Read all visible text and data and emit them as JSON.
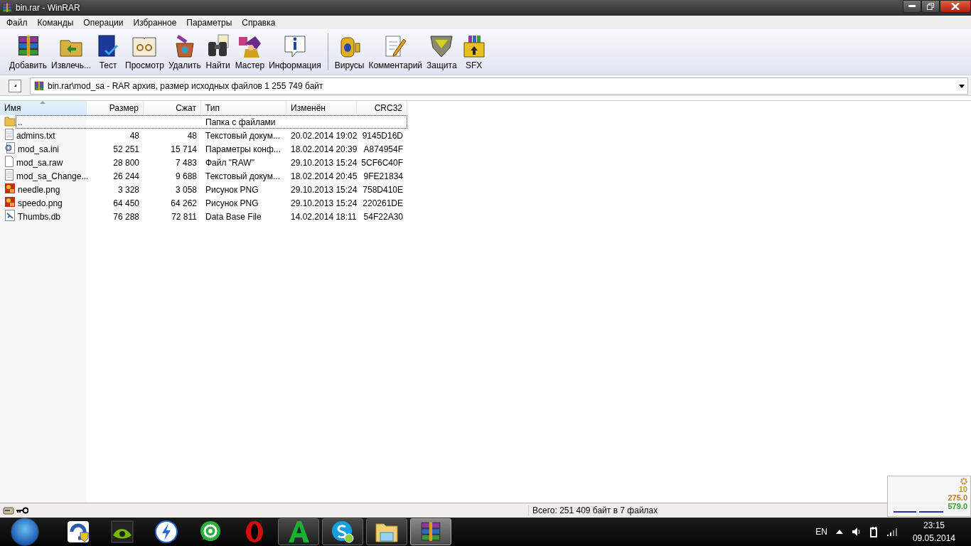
{
  "window": {
    "title": "bin.rar - WinRAR"
  },
  "menu": [
    "Файл",
    "Команды",
    "Операции",
    "Избранное",
    "Параметры",
    "Справка"
  ],
  "toolbar": {
    "groups": [
      [
        {
          "label": "Добавить",
          "kind": "add"
        },
        {
          "label": "Извлечь...",
          "kind": "extract"
        },
        {
          "label": "Тест",
          "kind": "test"
        },
        {
          "label": "Просмотр",
          "kind": "view"
        },
        {
          "label": "Удалить",
          "kind": "delete"
        },
        {
          "label": "Найти",
          "kind": "find"
        },
        {
          "label": "Мастер",
          "kind": "wizard"
        },
        {
          "label": "Информация",
          "kind": "info"
        }
      ],
      [
        {
          "label": "Вирусы",
          "kind": "virus"
        },
        {
          "label": "Комментарий",
          "kind": "comment"
        },
        {
          "label": "Защита",
          "kind": "protect"
        },
        {
          "label": "SFX",
          "kind": "sfx"
        }
      ]
    ]
  },
  "address": {
    "path": "bin.rar\\mod_sa - RAR архив, размер исходных файлов 1 255 749 байт"
  },
  "table": {
    "columns": [
      {
        "label": "Имя",
        "sorted": true
      },
      {
        "label": "Размер",
        "sorted": false
      },
      {
        "label": "Сжат",
        "sorted": false
      },
      {
        "label": "Тип",
        "sorted": false
      },
      {
        "label": "Изменён",
        "sorted": false
      },
      {
        "label": "CRC32",
        "sorted": false
      }
    ],
    "rows": [
      {
        "kind": "folder",
        "focused": true,
        "name": "..",
        "size": "",
        "packed": "",
        "type": "Папка с файлами",
        "modified": "",
        "crc": ""
      },
      {
        "kind": "text",
        "focused": false,
        "name": "admins.txt",
        "size": "48",
        "packed": "48",
        "type": "Текстовый докум...",
        "modified": "20.02.2014 19:02",
        "crc": "9145D16D"
      },
      {
        "kind": "settings",
        "focused": false,
        "name": "mod_sa.ini",
        "size": "52 251",
        "packed": "15 714",
        "type": "Параметры конф...",
        "modified": "18.02.2014 20:39",
        "crc": "A874954F"
      },
      {
        "kind": "file",
        "focused": false,
        "name": "mod_sa.raw",
        "size": "28 800",
        "packed": "7 483",
        "type": "Файл \"RAW\"",
        "modified": "29.10.2013 15:24",
        "crc": "5CF6C40F"
      },
      {
        "kind": "text",
        "focused": false,
        "name": "mod_sa_Change...",
        "size": "26 244",
        "packed": "9 688",
        "type": "Текстовый докум...",
        "modified": "18.02.2014 20:45",
        "crc": "9FE21834"
      },
      {
        "kind": "image",
        "focused": false,
        "name": "needle.png",
        "size": "3 328",
        "packed": "3 058",
        "type": "Рисунок PNG",
        "modified": "29.10.2013 15:24",
        "crc": "758D410E"
      },
      {
        "kind": "image",
        "focused": false,
        "name": "speedo.png",
        "size": "64 450",
        "packed": "64 262",
        "type": "Рисунок PNG",
        "modified": "29.10.2013 15:24",
        "crc": "220261DE"
      },
      {
        "kind": "db",
        "focused": false,
        "name": "Thumbs.db",
        "size": "76 288",
        "packed": "72 811",
        "type": "Data Base File",
        "modified": "14.02.2014 18:11",
        "crc": "54F22A30"
      }
    ]
  },
  "status_bar": {
    "summary": "Всего: 251 409 байт в 7 файлах"
  },
  "gadget": {
    "readings": [
      {
        "text": "10",
        "color": "#b8a800"
      },
      {
        "text": "275.0",
        "color": "#c07820"
      },
      {
        "text": "579.0",
        "color": "#30a030"
      }
    ]
  },
  "taskbar": {
    "apps": [
      {
        "kind": "shield",
        "running": false,
        "active": false
      },
      {
        "kind": "nvidia",
        "running": false,
        "active": false
      },
      {
        "kind": "bolt",
        "running": false,
        "active": false
      },
      {
        "kind": "at",
        "running": false,
        "active": false
      },
      {
        "kind": "opera",
        "running": false,
        "active": false
      },
      {
        "kind": "letter",
        "running": true,
        "active": false
      },
      {
        "kind": "skype",
        "running": true,
        "active": false
      },
      {
        "kind": "explorer",
        "running": true,
        "active": false
      },
      {
        "kind": "winrar",
        "running": true,
        "active": true
      }
    ],
    "language": "EN",
    "time": "23:15",
    "date": "09.05.2014"
  }
}
